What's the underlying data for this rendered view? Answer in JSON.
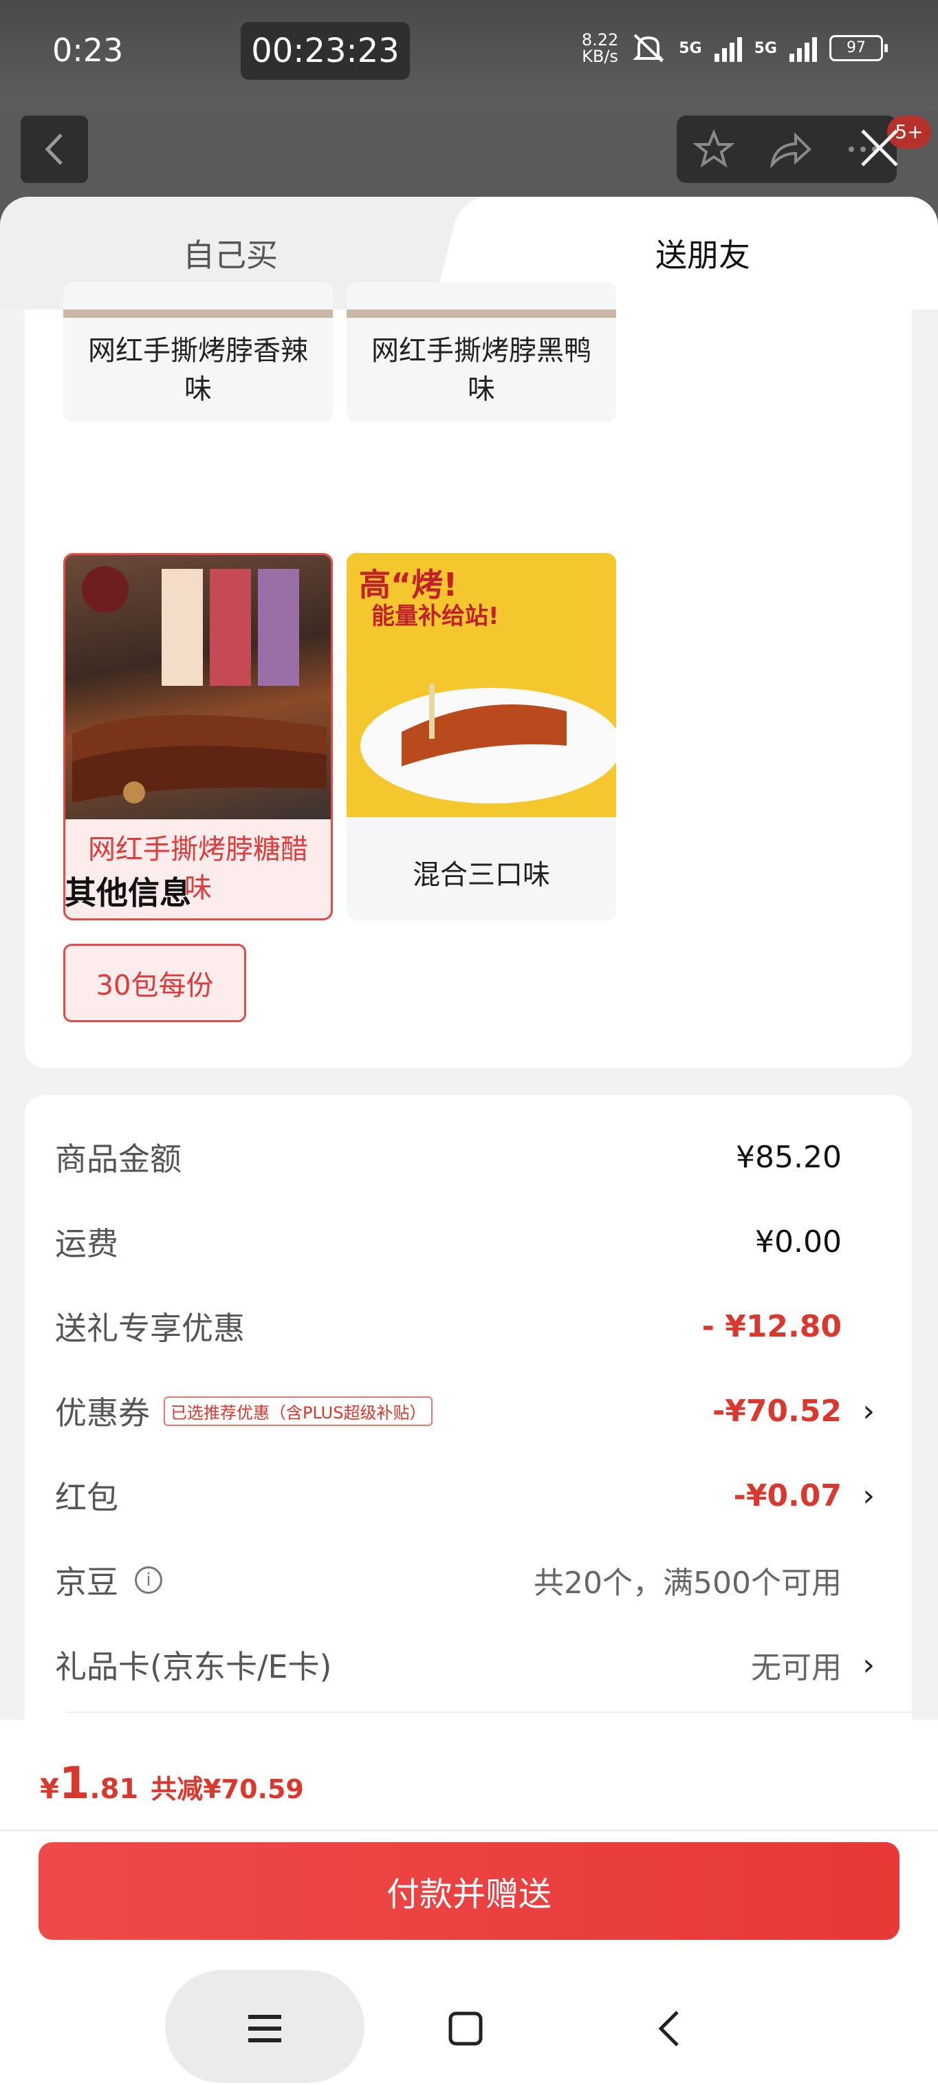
{
  "status_bar": {
    "time": "0:23",
    "timer": "00:23:23",
    "net_speed_top": "8.22",
    "net_speed_unit": "KB/s",
    "signal_1": "5G",
    "signal_2": "5G",
    "battery": "97"
  },
  "header": {
    "badge": "5+"
  },
  "tabs": {
    "buy_self": "自己买",
    "send_friend": "送朋友",
    "active": "送朋友"
  },
  "variants": [
    {
      "label": "网红手撕烤脖香辣味",
      "selected": false
    },
    {
      "label": "网红手撕烤脖黑鸭味",
      "selected": false
    },
    {
      "label": "网红手撕烤脖糖醋味",
      "selected": true
    },
    {
      "label": "混合三口味",
      "selected": false
    }
  ],
  "promo_image": {
    "line1": "高“烤!",
    "line2": "能量补给站!"
  },
  "other_info": {
    "title": "其他信息",
    "option": "30包每份"
  },
  "summary": {
    "goods_amount_label": "商品金额",
    "goods_amount": "¥85.20",
    "shipping_label": "运费",
    "shipping": "¥0.00",
    "gift_discount_label": "送礼专享优惠",
    "gift_discount": "- ¥12.80",
    "coupon_label": "优惠券",
    "coupon_tag": "已选推荐优惠（含PLUS超级补贴）",
    "coupon": "-¥70.52",
    "redpacket_label": "红包",
    "redpacket": "-¥0.07",
    "jingdou_label": "京豆",
    "jingdou": "共20个，满500个可用",
    "giftcard_label": "礼品卡(京东卡/E卡)",
    "giftcard": "无可用"
  },
  "footer": {
    "currency": "¥",
    "price_int": "1",
    "price_dec": ".81",
    "total_reduce": "共减¥70.59",
    "pay_button": "付款并赠送"
  },
  "colors": {
    "accent": "#e83838",
    "accent_text": "#d8382e"
  }
}
